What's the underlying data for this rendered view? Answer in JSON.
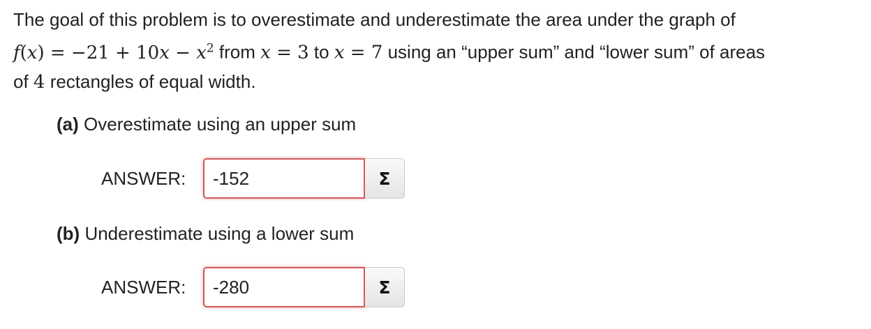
{
  "problem": {
    "intro": "The goal of this problem is to overestimate and underestimate the area under the graph of",
    "func_name": "f",
    "func_arg": "x",
    "equals": " = −21 + 10",
    "term_x": "x",
    "minus": " − ",
    "term_x2": "x",
    "exponent": "2",
    "from_text": " from ",
    "from_var": "x",
    "from_val": " = 3",
    "to_text": " to ",
    "to_var": "x",
    "to_val": " = 7",
    "after_bounds": " using an “upper sum” and “lower sum” of areas",
    "of_text": "of ",
    "num_rects": "4",
    "end_text": " rectangles of equal width."
  },
  "parts": [
    {
      "letter": "(a)",
      "prompt": "Overestimate using an upper sum",
      "answer_label": "ANSWER:",
      "answer_value": "-152",
      "sigma_label": "Σ"
    },
    {
      "letter": "(b)",
      "prompt": "Underestimate using a lower sum",
      "answer_label": "ANSWER:",
      "answer_value": "-280",
      "sigma_label": "Σ"
    }
  ]
}
